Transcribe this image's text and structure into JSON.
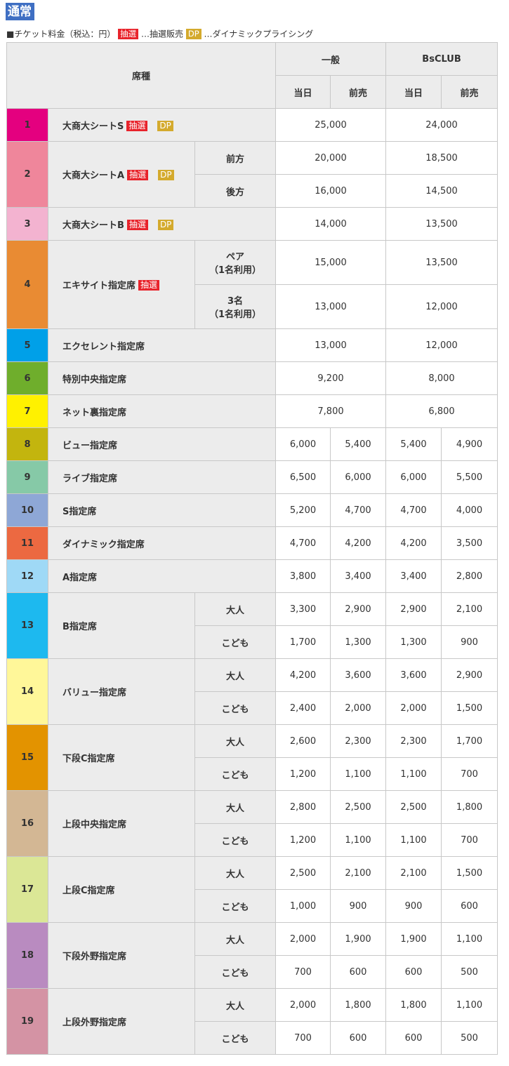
{
  "title": "通常",
  "legend": {
    "prefix": "■チケット料金（税込：円）",
    "lottery_badge": "抽選",
    "lottery_text": "…抽選販売",
    "dp_badge": "DP",
    "dp_text": "…ダイナミックプライシング"
  },
  "header": {
    "seat_type": "席種",
    "general": "一般",
    "bsclub": "BsCLUB",
    "same_day": "当日",
    "advance": "前売"
  },
  "badges": {
    "lottery": "抽選",
    "dp": "DP"
  },
  "rows": [
    {
      "num": "1",
      "color": "#e4007f",
      "name": "大商大シートS",
      "lottery": true,
      "dp": true,
      "merged": true,
      "subs": [
        {
          "label": "",
          "gen": "25,000",
          "bs": "24,000"
        }
      ]
    },
    {
      "num": "2",
      "color": "#ef869b",
      "name": "大商大シートA",
      "lottery": true,
      "dp": true,
      "merged": true,
      "subs": [
        {
          "label": "前方",
          "gen": "20,000",
          "bs": "18,500"
        },
        {
          "label": "後方",
          "gen": "16,000",
          "bs": "14,500"
        }
      ]
    },
    {
      "num": "3",
      "color": "#f3b3d0",
      "name": "大商大シートB",
      "lottery": true,
      "dp": true,
      "merged": true,
      "subs": [
        {
          "label": "",
          "gen": "14,000",
          "bs": "13,500"
        }
      ]
    },
    {
      "num": "4",
      "color": "#e98b33",
      "name": "エキサイト指定席",
      "lottery": true,
      "dp": false,
      "merged": true,
      "subs": [
        {
          "label": "ペア\n（1名利用）",
          "gen": "15,000",
          "bs": "13,500"
        },
        {
          "label": "3名\n（1名利用）",
          "gen": "13,000",
          "bs": "12,000"
        }
      ]
    },
    {
      "num": "5",
      "color": "#00a0e8",
      "name": "エクセレント指定席",
      "merged": true,
      "subs": [
        {
          "label": "",
          "gen": "13,000",
          "bs": "12,000"
        }
      ]
    },
    {
      "num": "6",
      "color": "#6fae2c",
      "name": "特別中央指定席",
      "merged": true,
      "subs": [
        {
          "label": "",
          "gen": "9,200",
          "bs": "8,000"
        }
      ]
    },
    {
      "num": "7",
      "color": "#fff100",
      "name": "ネット裏指定席",
      "merged": true,
      "subs": [
        {
          "label": "",
          "gen": "7,800",
          "bs": "6,800"
        }
      ]
    },
    {
      "num": "8",
      "color": "#c3b50e",
      "name": "ビュー指定席",
      "subs": [
        {
          "label": "",
          "p": [
            "6,000",
            "5,400",
            "5,400",
            "4,900"
          ]
        }
      ]
    },
    {
      "num": "9",
      "color": "#86c9a7",
      "name": "ライブ指定席",
      "subs": [
        {
          "label": "",
          "p": [
            "6,500",
            "6,000",
            "6,000",
            "5,500"
          ]
        }
      ]
    },
    {
      "num": "10",
      "color": "#8ea7d6",
      "name": "S指定席",
      "subs": [
        {
          "label": "",
          "p": [
            "5,200",
            "4,700",
            "4,700",
            "4,000"
          ]
        }
      ]
    },
    {
      "num": "11",
      "color": "#ec6941",
      "name": "ダイナミック指定席",
      "subs": [
        {
          "label": "",
          "p": [
            "4,700",
            "4,200",
            "4,200",
            "3,500"
          ]
        }
      ]
    },
    {
      "num": "12",
      "color": "#9fd9f6",
      "name": "A指定席",
      "subs": [
        {
          "label": "",
          "p": [
            "3,800",
            "3,400",
            "3,400",
            "2,800"
          ]
        }
      ]
    },
    {
      "num": "13",
      "color": "#1db9ef",
      "name": "B指定席",
      "subs": [
        {
          "label": "大人",
          "p": [
            "3,300",
            "2,900",
            "2,900",
            "2,100"
          ]
        },
        {
          "label": "こども",
          "p": [
            "1,700",
            "1,300",
            "1,300",
            "900"
          ]
        }
      ]
    },
    {
      "num": "14",
      "color": "#fff799",
      "name": "バリュー指定席",
      "subs": [
        {
          "label": "大人",
          "p": [
            "4,200",
            "3,600",
            "3,600",
            "2,900"
          ]
        },
        {
          "label": "こども",
          "p": [
            "2,400",
            "2,000",
            "2,000",
            "1,500"
          ]
        }
      ]
    },
    {
      "num": "15",
      "color": "#e39300",
      "name": "下段C指定席",
      "subs": [
        {
          "label": "大人",
          "p": [
            "2,600",
            "2,300",
            "2,300",
            "1,700"
          ]
        },
        {
          "label": "こども",
          "p": [
            "1,200",
            "1,100",
            "1,100",
            "700"
          ]
        }
      ]
    },
    {
      "num": "16",
      "color": "#d3b794",
      "name": "上段中央指定席",
      "subs": [
        {
          "label": "大人",
          "p": [
            "2,800",
            "2,500",
            "2,500",
            "1,800"
          ]
        },
        {
          "label": "こども",
          "p": [
            "1,200",
            "1,100",
            "1,100",
            "700"
          ]
        }
      ]
    },
    {
      "num": "17",
      "color": "#dbe796",
      "name": "上段C指定席",
      "subs": [
        {
          "label": "大人",
          "p": [
            "2,500",
            "2,100",
            "2,100",
            "1,500"
          ]
        },
        {
          "label": "こども",
          "p": [
            "1,000",
            "900",
            "900",
            "600"
          ]
        }
      ]
    },
    {
      "num": "18",
      "color": "#b98bc0",
      "name": "下段外野指定席",
      "subs": [
        {
          "label": "大人",
          "p": [
            "2,000",
            "1,900",
            "1,900",
            "1,100"
          ]
        },
        {
          "label": "こども",
          "p": [
            "700",
            "600",
            "600",
            "500"
          ]
        }
      ]
    },
    {
      "num": "19",
      "color": "#d493a4",
      "name": "上段外野指定席",
      "subs": [
        {
          "label": "大人",
          "p": [
            "2,000",
            "1,800",
            "1,800",
            "1,100"
          ]
        },
        {
          "label": "こども",
          "p": [
            "700",
            "600",
            "600",
            "500"
          ]
        }
      ]
    }
  ]
}
